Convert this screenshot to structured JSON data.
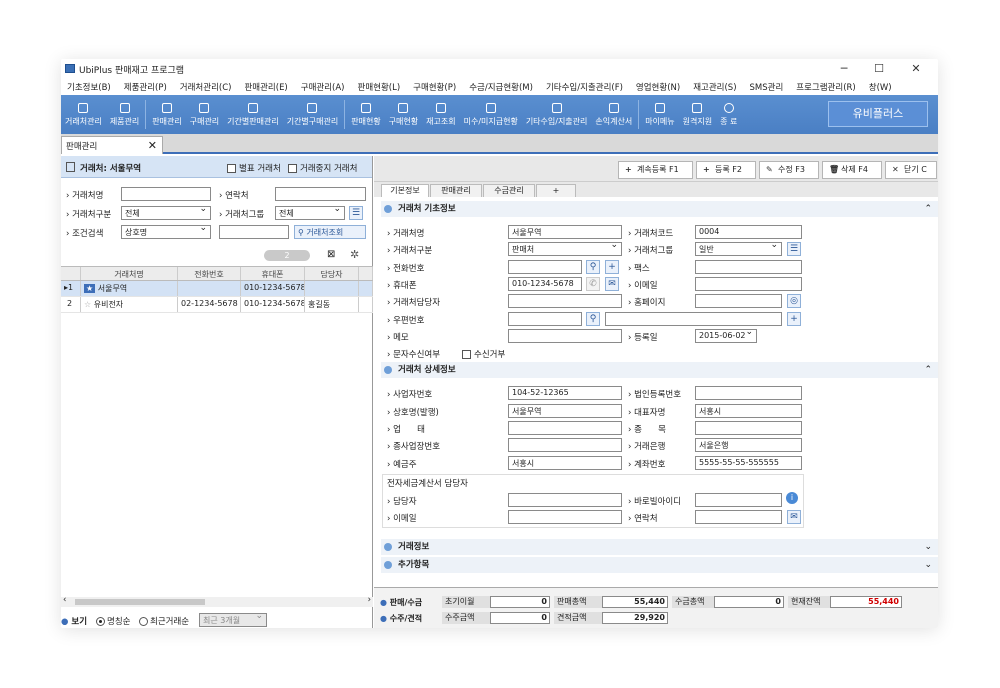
{
  "window": {
    "title": "UbiPlus 판매재고 프로그램",
    "min": "─",
    "max": "☐",
    "close": "✕"
  },
  "menu": [
    "기초정보(B)",
    "제품관리(P)",
    "거래처관리(C)",
    "판매관리(E)",
    "구매관리(A)",
    "판매현황(L)",
    "구매현황(P)",
    "수금/지급현황(M)",
    "기타수입/지출관리(F)",
    "영업현황(N)",
    "재고관리(S)",
    "SMS관리",
    "프로그램관리(R)",
    "창(W)"
  ],
  "toolbar": [
    "거래처관리",
    "제품관리",
    "판매관리",
    "구매관리",
    "기간별판매관리",
    "기간별구매관리",
    "판매현황",
    "구매현황",
    "재고조회",
    "미수/미지급현황",
    "기타수입/지출관리",
    "손익계산서",
    "마이메뉴",
    "원격지원",
    "종 료"
  ],
  "brand": "유비플러스",
  "tab": {
    "label": "판매관리",
    "close": "✕"
  },
  "left": {
    "header": "거래처: 서울무역",
    "chk_bill": "별표 거래처",
    "chk_stop": "거래중지 거래처",
    "lbl_name": "거래처명",
    "lbl_contact": "연락처",
    "lbl_type": "거래처구분",
    "type_val": "전체",
    "lbl_group": "거래처그룹",
    "group_val": "전체",
    "lbl_cond": "조건검색",
    "cond_val": "상호명",
    "search_btn": "거래처조회",
    "count": "2",
    "columns": [
      "거래처명",
      "전화번호",
      "휴대폰",
      "담당자"
    ],
    "rows": [
      {
        "no": "1",
        "name": "서울무역",
        "tel": "",
        "mobile": "010-1234-5678",
        "manager": ""
      },
      {
        "no": "2",
        "name": "유비전자",
        "tel": "02-1234-5678",
        "mobile": "010-1234-5678",
        "manager": "홍길동"
      }
    ],
    "view": "보기",
    "r1": "명칭순",
    "r2": "최근거래순",
    "period": "최근 3개월"
  },
  "actions": [
    "계속등록 F1",
    "등록 F2",
    "수정 F3",
    "삭제 F4",
    "닫기 C"
  ],
  "rtabs": [
    "기본정보",
    "판매관리",
    "수금관리",
    "+"
  ],
  "basic": {
    "title": "거래처 기초정보",
    "name_l": "거래처명",
    "name": "서울무역",
    "code_l": "거래처코드",
    "code": "0004",
    "type_l": "거래처구분",
    "type": "판매처",
    "group_l": "거래처그룹",
    "group": "일반",
    "tel_l": "전화번호",
    "fax_l": "팩스",
    "mobile_l": "휴대폰",
    "mobile": "010-1234-5678",
    "email_l": "이메일",
    "mgr_l": "거래처담당자",
    "home_l": "홈페이지",
    "zip_l": "우편번호",
    "memo_l": "메모",
    "reg_l": "등록일",
    "reg": "2015-06-02",
    "sms_l": "문자수신여부",
    "sms_chk": "수신거부"
  },
  "detail": {
    "title": "거래처 상세정보",
    "biz_l": "사업자번호",
    "biz": "104-52-12365",
    "corp_l": "법인등록번호",
    "firm_l": "상호명(발행)",
    "firm": "서울무역",
    "ceo_l": "대표자명",
    "ceo": "서홍시",
    "up_l": "업      태",
    "jong_l": "종      목",
    "sub_l": "종사업장번호",
    "bank_l": "거래은행",
    "bank": "서울은행",
    "holder_l": "예금주",
    "holder": "서홍시",
    "acct_l": "계좌번호",
    "acct": "5555-55-55-555555",
    "tax_title": "전자세금계산서 담당자",
    "tmgr_l": "담당자",
    "bar_l": "바로빌아이디",
    "temail_l": "이메일",
    "tcontact_l": "연락처"
  },
  "sec3": "거래정보",
  "sec4": "추가항목",
  "bottom": {
    "row1_l": "판매/수금",
    "init_l": "초기이월",
    "init": "0",
    "sale_l": "판매총액",
    "sale": "55,440",
    "col_l": "수금총액",
    "col": "0",
    "bal_l": "현재잔액",
    "bal": "55,440",
    "row2_l": "수주/견적",
    "ord_l": "수주금액",
    "ord": "0",
    "est_l": "견적금액",
    "est": "29,920"
  },
  "colors": {
    "toolbar": "#4a7fc4",
    "accent": "#3d6eb8",
    "balance": "#d00000"
  }
}
